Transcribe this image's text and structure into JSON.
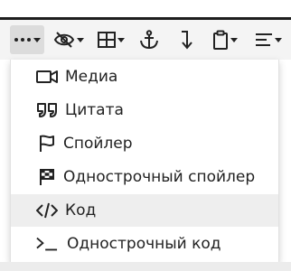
{
  "toolbar": {
    "buttons": [
      {
        "name": "more-button",
        "icon": "ellipsis-icon",
        "dropdown": true,
        "active": true
      },
      {
        "name": "hide-button",
        "icon": "eye-off-icon",
        "dropdown": true
      },
      {
        "name": "table-button",
        "icon": "table-icon",
        "dropdown": true
      },
      {
        "name": "anchor-button",
        "icon": "anchor-icon",
        "dropdown": false
      },
      {
        "name": "line-break-button",
        "icon": "arrow-down-icon",
        "dropdown": false
      },
      {
        "name": "paste-button",
        "icon": "clipboard-icon",
        "dropdown": true
      },
      {
        "name": "align-button",
        "icon": "align-left-icon",
        "dropdown": true
      }
    ]
  },
  "menu": {
    "items": [
      {
        "label": "Медиа",
        "icon": "video-camera-icon"
      },
      {
        "label": "Цитата",
        "icon": "quote-icon"
      },
      {
        "label": "Спойлер",
        "icon": "flag-icon"
      },
      {
        "label": "Однострочный спойлер",
        "icon": "checkered-flag-icon"
      },
      {
        "label": "Код",
        "icon": "code-icon",
        "highlighted": true
      },
      {
        "label": "Однострочный код",
        "icon": "terminal-icon"
      }
    ]
  }
}
